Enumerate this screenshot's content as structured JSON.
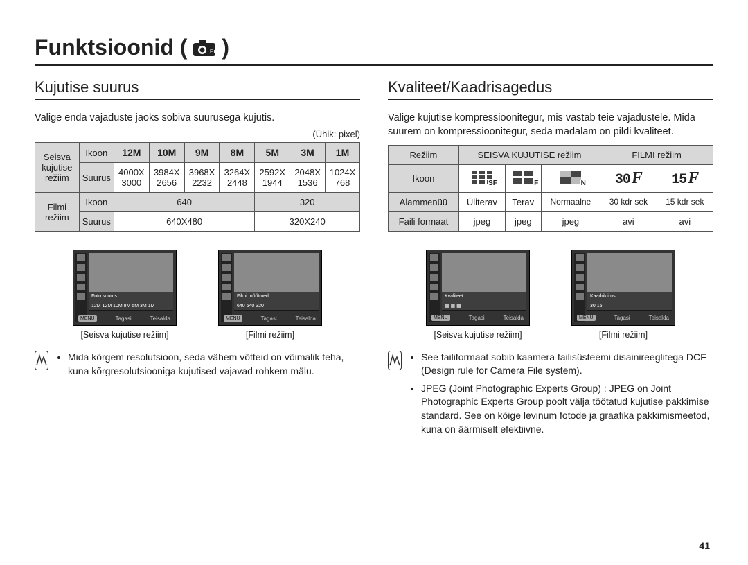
{
  "page_title": "Funktsioonid (",
  "page_title_suffix": " )",
  "page_number": "41",
  "left": {
    "section_title": "Kujutise suurus",
    "intro": "Valige enda vajaduste jaoks sobiva suurusega kujutis.",
    "unit_label": "(Ühik: pixel)",
    "row_groups": [
      {
        "group": "Seisva kujutise režiim",
        "icon_label": "Ikoon",
        "size_label": "Suurus"
      },
      {
        "group": "Filmi režiim",
        "icon_label": "Ikoon",
        "size_label": "Suurus"
      }
    ],
    "still": {
      "icons": [
        "12M",
        "10M",
        "9M",
        "8M",
        "5M",
        "3M",
        "1M"
      ],
      "sizes": [
        "4000X 3000",
        "3984X 2656",
        "3968X 2232",
        "3264X 2448",
        "2592X 1944",
        "2048X 1536",
        "1024X 768"
      ]
    },
    "movie": {
      "icons": [
        "640",
        "320"
      ],
      "sizes": [
        "640X480",
        "320X240"
      ]
    },
    "thumbs": [
      {
        "caption": "[Seisva kujutise režiim]",
        "bar": "Foto suurus",
        "row": "12M 12M 10M 8M 5M 3M 1M",
        "menu": "MENU",
        "back": "Tagasi",
        "move": "Teisalda"
      },
      {
        "caption": "[Filmi režiim]",
        "bar": "Filmi mõõtmed",
        "row": "640 640 320",
        "menu": "MENU",
        "back": "Tagasi",
        "move": "Teisalda"
      }
    ],
    "note_items": [
      "Mida kõrgem resolutsioon, seda vähem võtteid on võimalik teha, kuna kõrgresolutsiooniga kujutised vajavad rohkem mälu."
    ]
  },
  "right": {
    "section_title": "Kvaliteet/Kaadrisagedus",
    "intro": "Valige kujutise kompressioonitegur, mis vastab teie vajadustele. Mida suurem on kompressioonitegur, seda madalam on pildi kvaliteet.",
    "header_rows": {
      "mode": "Režiim",
      "still_mode": "SEISVA KUJUTISE režiim",
      "movie_mode": "FILMI režiim",
      "icon": "Ikoon",
      "submenu": "Alammenüü",
      "file_format": "Faili formaat"
    },
    "submenu_values": [
      "Üliterav",
      "Terav",
      "Normaalne",
      "30 kdr sek",
      "15 kdr sek"
    ],
    "format_values": [
      "jpeg",
      "jpeg",
      "jpeg",
      "avi",
      "avi"
    ],
    "frame_icons": [
      "30",
      "15"
    ],
    "thumbs": [
      {
        "caption": "[Seisva kujutise režiim]",
        "bar": "Kvaliteet",
        "menu": "MENU",
        "back": "Tagasi",
        "move": "Teisalda"
      },
      {
        "caption": "[Filmi režiim]",
        "bar": "Kaadrikiirus",
        "menu": "MENU",
        "back": "Tagasi",
        "move": "Teisalda"
      }
    ],
    "note_items": [
      "See failiformaat sobib kaamera failisüsteemi disainireeglitega DCF (Design rule for Camera File system).",
      "JPEG (Joint Photographic Experts Group) : JPEG on Joint Photographic Experts Group poolt välja töötatud kujutise pakkimise standard. See on kõige levinum fotode ja graafika pakkimismeetod, kuna on äärmiselt efektiivne."
    ]
  }
}
